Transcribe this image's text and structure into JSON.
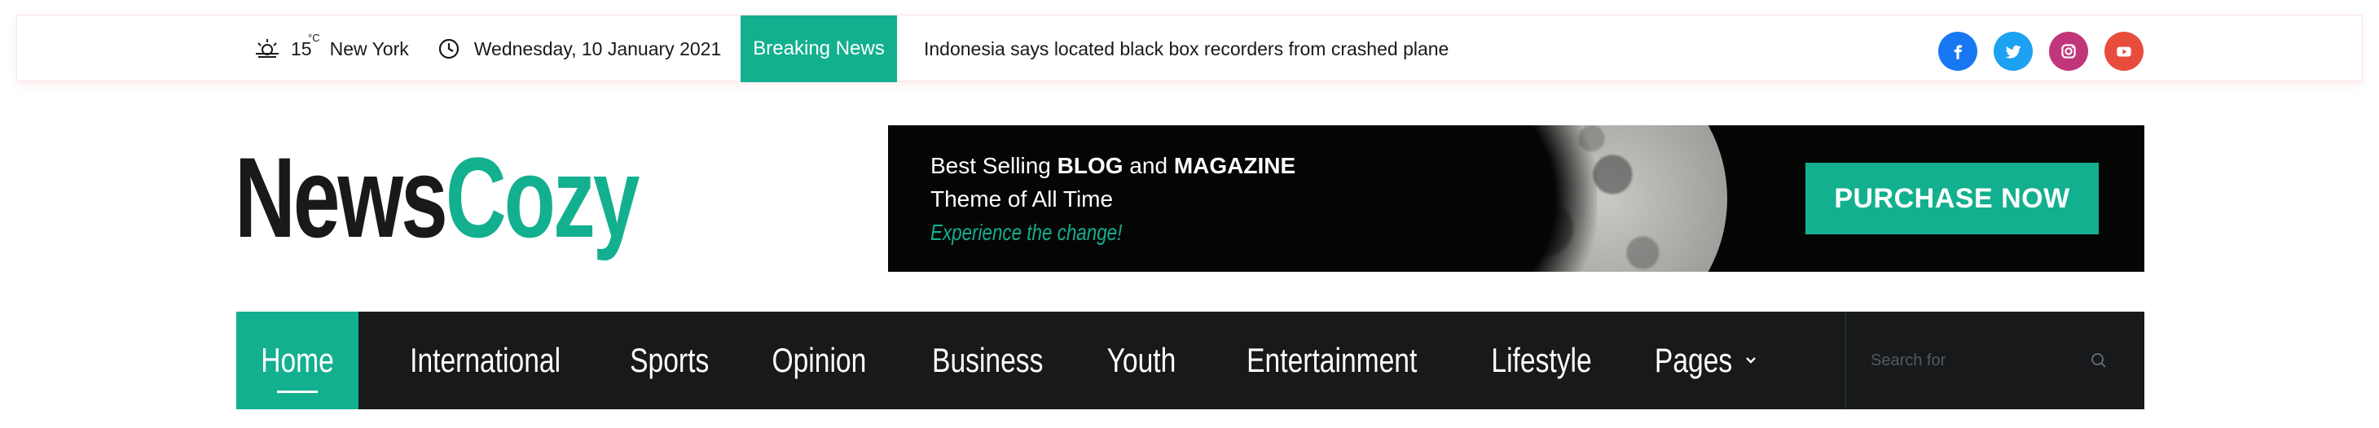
{
  "topbar": {
    "weather": {
      "temp": "15",
      "unit": "°C",
      "city": "New York",
      "icon": "sun-cloud-icon"
    },
    "date": "Wednesday, 10 January 2021",
    "breaking_label": "Breaking News",
    "ticker_text": "Indonesia says located black box recorders from crashed plane",
    "socials": [
      {
        "name": "facebook",
        "icon": "facebook-icon",
        "color": "#1877f2"
      },
      {
        "name": "twitter",
        "icon": "twitter-icon",
        "color": "#1da1f2"
      },
      {
        "name": "instagram",
        "icon": "instagram-icon",
        "color": "#c1357a"
      },
      {
        "name": "youtube",
        "icon": "youtube-icon",
        "color": "#e84c3d"
      }
    ]
  },
  "logo": {
    "part1": "News",
    "part2": "Cozy"
  },
  "banner": {
    "line1_pre": "Best Selling ",
    "line1_blog": "BLOG",
    "line1_mid": " and ",
    "line1_magazine": "MAGAZINE",
    "line2": "Theme of All Time",
    "line3": "Experience the change!",
    "cta": "PURCHASE NOW"
  },
  "nav": {
    "items": [
      {
        "label": "Home",
        "active": true
      },
      {
        "label": "International"
      },
      {
        "label": "Sports"
      },
      {
        "label": "Opinion"
      },
      {
        "label": "Business"
      },
      {
        "label": "Youth"
      },
      {
        "label": "Entertainment"
      },
      {
        "label": "Lifestyle"
      },
      {
        "label": "Pages",
        "dropdown": true
      }
    ],
    "search_placeholder": "Search for"
  },
  "colors": {
    "accent": "#13b08f",
    "dark": "#17191b"
  }
}
